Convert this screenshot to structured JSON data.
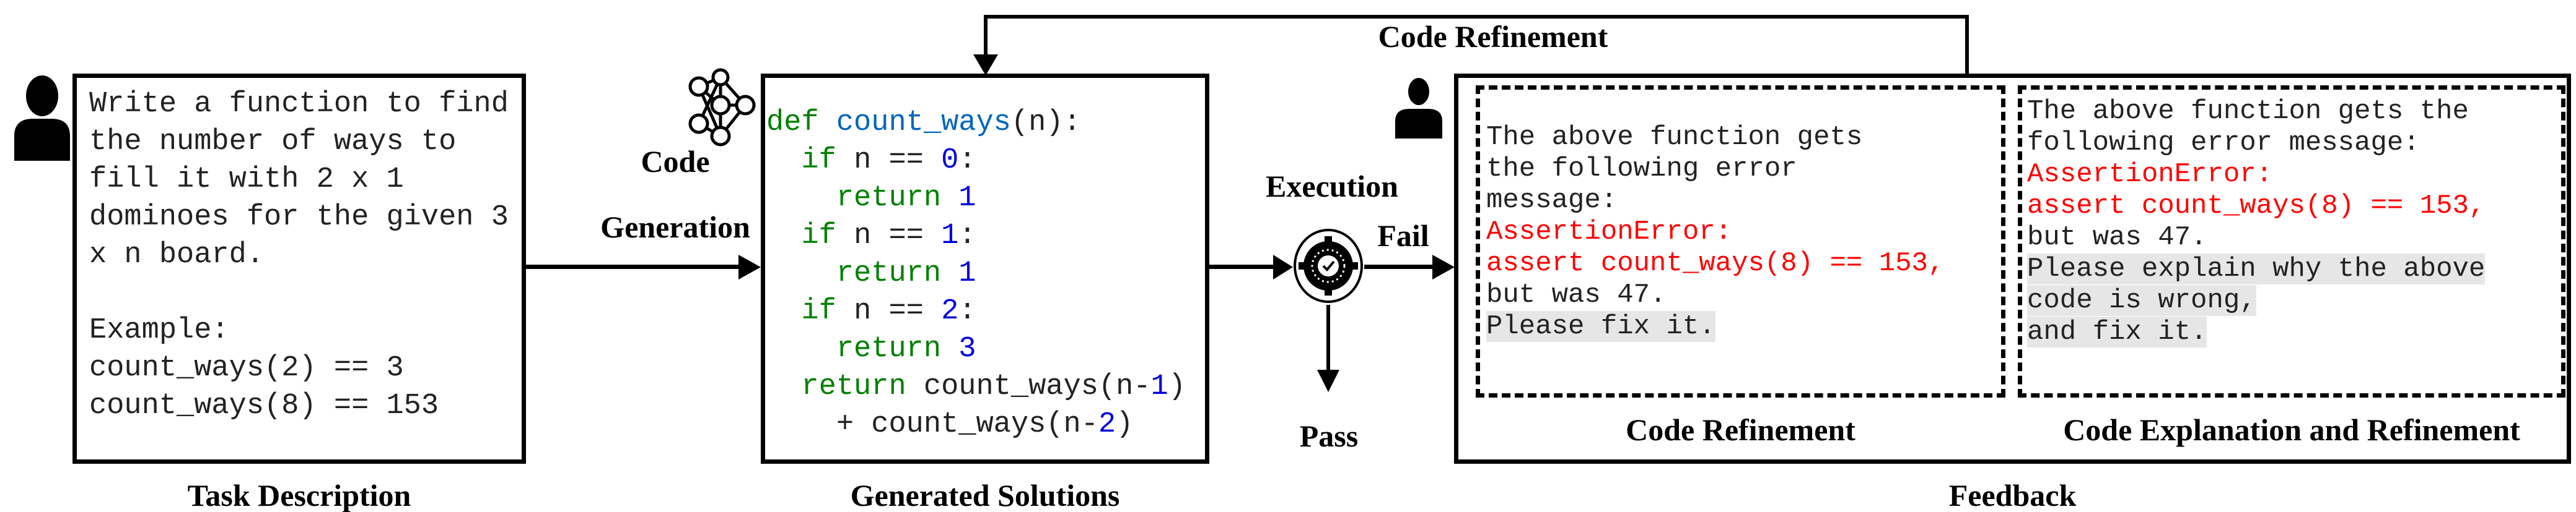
{
  "task": {
    "lines": [
      "Write a function to find",
      "the number of ways to",
      "fill it with 2 x 1",
      "dominoes for the given 3",
      "x n board.",
      "",
      "Example:",
      "count_ways(2) == 3",
      "count_ways(8) == 153"
    ],
    "caption": "Task Description"
  },
  "generation_label": [
    "Code",
    "Generation"
  ],
  "solution": {
    "caption": "Generated Solutions",
    "def": "def",
    "name": "count_ways",
    "sig": "(n):",
    "if": "if",
    "cond": "n ==",
    "colon": ":",
    "ret": "return",
    "n0": "0",
    "n1": "1",
    "n2": "2",
    "r3": "3",
    "last1": "count_ways(n-",
    "last1_num": "1",
    "last1_end": ")",
    "last2": "+ count_ways(n-",
    "last2_num": "2",
    "last2_end": ")"
  },
  "execution": {
    "label": "Execution",
    "fail": "Fail",
    "pass": "Pass"
  },
  "top_loop_label": "Code Refinement",
  "feedback": {
    "caption": "Feedback",
    "refine": {
      "caption": "Code Refinement",
      "lines": [
        "The above function gets",
        "the following error",
        "message:"
      ],
      "err1": "AssertionError:",
      "err2": "assert count_ways(8) == 153,",
      "tail": "but was 47.",
      "ask": "Please fix it."
    },
    "explain": {
      "caption": "Code Explanation and Refinement",
      "lines": [
        "The above function gets the",
        "following error message:"
      ],
      "err1": "AssertionError:",
      "err2": "assert count_ways(8) == 153,",
      "tail": "but was 47.",
      "ask": [
        "Please explain why the above",
        "code is wrong,",
        "and fix it."
      ]
    }
  },
  "colors": {
    "keyword": "#008000",
    "function": "#0066bb",
    "number": "#0000dd",
    "error": "#ff0000",
    "highlight": "#e6e6e6"
  }
}
